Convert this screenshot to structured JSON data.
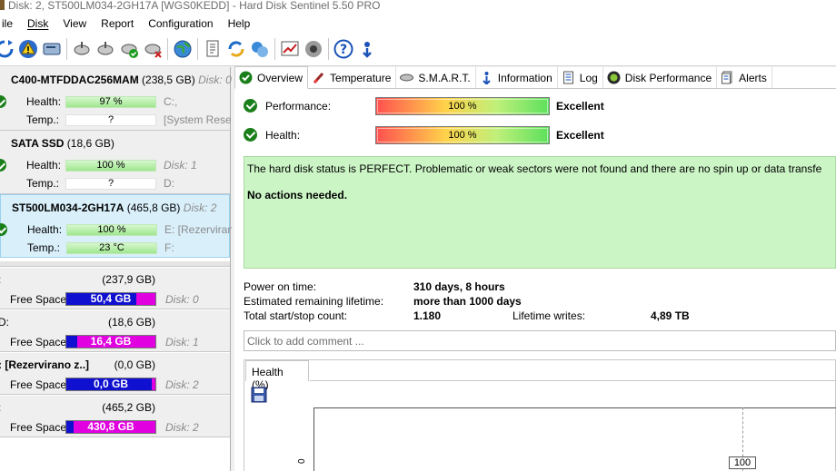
{
  "window": {
    "title": "Disk: 2, ST500LM034-2GH17A [WGS0KEDD]  -  Hard Disk Sentinel 5.50 PRO"
  },
  "menu": [
    {
      "label": "ile",
      "key": "file"
    },
    {
      "label": "Disk",
      "key": "disk"
    },
    {
      "label": "View",
      "key": "view"
    },
    {
      "label": "Report",
      "key": "report"
    },
    {
      "label": "Configuration",
      "key": "configuration"
    },
    {
      "label": "Help",
      "key": "help"
    }
  ],
  "toolbar": {
    "icons": [
      "refresh-icon",
      "alert-icon",
      "disk-icon",
      "satellite-icon",
      "satellite-icon",
      "satellite-ok-icon",
      "satellite-error-icon",
      "globe-icon",
      "report-icon",
      "sync-icon",
      "network-icon",
      "chart-icon",
      "speaker-icon",
      "help-icon",
      "update-icon"
    ]
  },
  "disks": [
    {
      "name": "C400-MTFDDAC256MAM",
      "size": "(238,5 GB)",
      "disk_no": "Disk: 0",
      "health_label": "Health:",
      "health": "97 %",
      "health_right": "C:,",
      "temp_label": "Temp.:",
      "temp": "?",
      "temp_right": "[System Rese"
    },
    {
      "name": "SATA SSD",
      "size": "(18,6 GB)",
      "disk_no": "",
      "health_label": "Health:",
      "health": "100 %",
      "health_right": "Disk: 1",
      "temp_label": "Temp.:",
      "temp": "?",
      "temp_right": "D:"
    },
    {
      "name": "ST500LM034-2GH17A",
      "size": "(465,8 GB)",
      "disk_no": "Disk: 2",
      "health_label": "Health:",
      "health": "100 %",
      "health_right": "E: [Rezervirano",
      "temp_label": "Temp.:",
      "temp": "23 °C",
      "temp_right": "F:"
    }
  ],
  "partitions": [
    {
      "name": ":",
      "size": "(237,9 GB)",
      "free_label": "Free Space",
      "free": "50,4 GB",
      "free_fraction": 0.79,
      "disk_no": "Disk: 0"
    },
    {
      "name": "D:",
      "size": "(18,6 GB)",
      "free_label": "Free Space",
      "free": "16,4 GB",
      "free_fraction": 0.12,
      "disk_no": "Disk: 1"
    },
    {
      "name": ": [Rezervirano z..]",
      "size": "(0,0 GB)",
      "free_label": "Free Space",
      "free": "0,0 GB",
      "free_fraction": 0.96,
      "disk_no": "Disk: 2"
    },
    {
      "name": ":",
      "size": "(465,2 GB)",
      "free_label": "Free Space",
      "free": "430,8 GB",
      "free_fraction": 0.08,
      "disk_no": "Disk: 2"
    }
  ],
  "tabs": [
    {
      "label": "Overview",
      "icon": "check-icon",
      "active": true
    },
    {
      "label": "Temperature",
      "icon": "thermometer-icon"
    },
    {
      "label": "S.M.A.R.T.",
      "icon": "smart-icon"
    },
    {
      "label": "Information",
      "icon": "info-icon"
    },
    {
      "label": "Log",
      "icon": "log-icon"
    },
    {
      "label": "Disk Performance",
      "icon": "performance-icon"
    },
    {
      "label": "Alerts",
      "icon": "alerts-icon"
    }
  ],
  "overview": {
    "performance_label": "Performance:",
    "performance_value": "100 %",
    "performance_rating": "Excellent",
    "health_label": "Health:",
    "health_value": "100 %",
    "health_rating": "Excellent",
    "status_message": "The hard disk status is PERFECT. Problematic or weak sectors were not found and there are no spin up or data transfe",
    "actions": "No actions needed.",
    "power_on_label": "Power on time:",
    "power_on_value": "310 days, 8 hours",
    "lifetime_label": "Estimated remaining lifetime:",
    "lifetime_value": "more than 1000 days",
    "startstop_label": "Total start/stop count:",
    "startstop_value": "1.180",
    "writes_label": "Lifetime writes:",
    "writes_value": "4,89 TB",
    "comment_placeholder": "Click to add comment ..."
  },
  "chart": {
    "tab_label": "Health (%)",
    "y_tick": "0",
    "point_label": "100"
  },
  "chart_data": {
    "type": "line",
    "title": "Health (%)",
    "x": [],
    "series": [
      {
        "values": [
          100
        ]
      }
    ],
    "data_labels": [
      "100"
    ]
  }
}
